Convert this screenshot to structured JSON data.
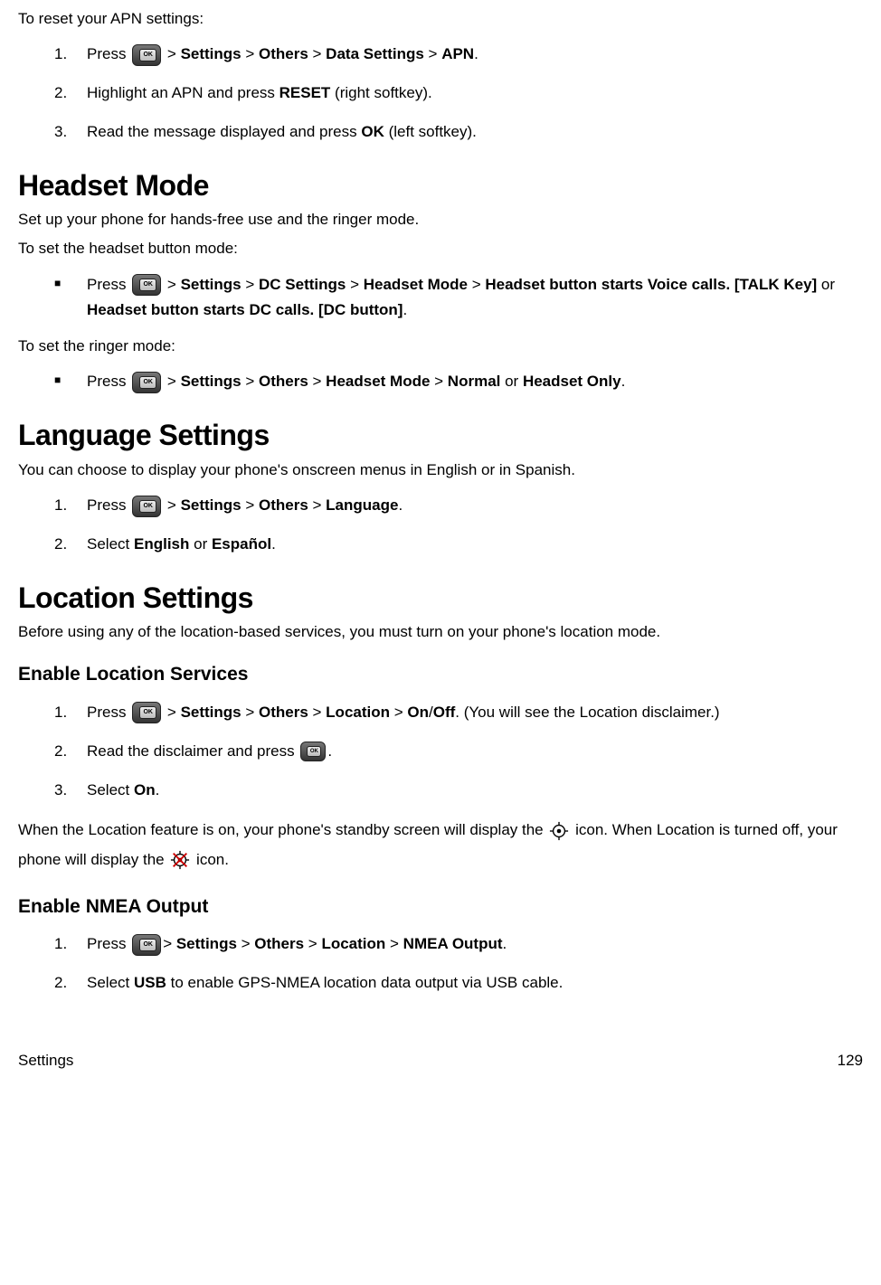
{
  "resetApn": {
    "intro": "To reset your APN settings:",
    "steps": [
      {
        "num": "1.",
        "parts": [
          "Press ",
          "[OK]",
          " > ",
          "Settings",
          " > ",
          "Others",
          " > ",
          "Data Settings",
          " > ",
          "APN",
          "."
        ]
      },
      {
        "num": "2.",
        "parts": [
          "Highlight an APN and press ",
          "RESET",
          " (right softkey)."
        ]
      },
      {
        "num": "3.",
        "parts": [
          "Read the message displayed and press ",
          "OK",
          " (left softkey)."
        ]
      }
    ]
  },
  "headsetMode": {
    "title": "Headset Mode",
    "intro": "Set up your phone for hands-free use and the ringer mode.",
    "subIntro1": "To set the headset button mode:",
    "bullet1": {
      "parts": [
        "Press ",
        "[OK]",
        " > ",
        "Settings",
        " > ",
        "DC Settings",
        " > ",
        "Headset Mode",
        " > ",
        "Headset button starts Voice calls. [TALK Key]",
        " or ",
        "Headset button starts DC calls. [DC button]",
        "."
      ]
    },
    "subIntro2": "To set the ringer mode:",
    "bullet2": {
      "parts": [
        "Press ",
        "[OK]",
        " > ",
        "Settings",
        " > ",
        "Others",
        " > ",
        "Headset Mode",
        " > ",
        "Normal",
        " or ",
        "Headset Only",
        "."
      ]
    }
  },
  "language": {
    "title": "Language Settings",
    "intro": "You can choose to display your phone's onscreen menus in English or in Spanish.",
    "steps": [
      {
        "num": "1.",
        "parts": [
          "Press ",
          "[OK]",
          " > ",
          "Settings",
          " > ",
          "Others",
          " > ",
          "Language",
          "."
        ]
      },
      {
        "num": "2.",
        "parts": [
          "Select ",
          "English",
          " or ",
          "Español",
          "."
        ]
      }
    ]
  },
  "location": {
    "title": "Location Settings",
    "intro": "Before using any of the location-based services, you must turn on your phone's location mode.",
    "enableTitle": "Enable Location Services",
    "enableSteps": [
      {
        "num": "1.",
        "parts": [
          "Press ",
          "[OK]",
          " > ",
          "Settings",
          " > ",
          "Others",
          " > ",
          "Location",
          " > ",
          "On",
          "/",
          "Off",
          ". (You will see the Location disclaimer.)"
        ]
      },
      {
        "num": "2.",
        "parts": [
          "Read the disclaimer and press ",
          "[OKSM]",
          "."
        ]
      },
      {
        "num": "3.",
        "parts": [
          "Select ",
          "On",
          "."
        ]
      }
    ],
    "iconPara": {
      "parts": [
        "When the Location feature is on, your phone's standby screen will display the ",
        "[LOCON]",
        " icon. When Location is turned off, your phone will display the ",
        "[LOCOFF]",
        " icon."
      ]
    },
    "nmeaTitle": "Enable NMEA Output",
    "nmeaSteps": [
      {
        "num": "1.",
        "parts": [
          "Press ",
          "[OK]",
          "> ",
          "Settings",
          " > ",
          "Others",
          " > ",
          "Location",
          " > ",
          "NMEA Output",
          "."
        ]
      },
      {
        "num": "2.",
        "parts": [
          "Select ",
          "USB",
          " to enable GPS-NMEA location data output via USB cable."
        ]
      }
    ]
  },
  "footer": {
    "left": "Settings",
    "right": "129"
  }
}
